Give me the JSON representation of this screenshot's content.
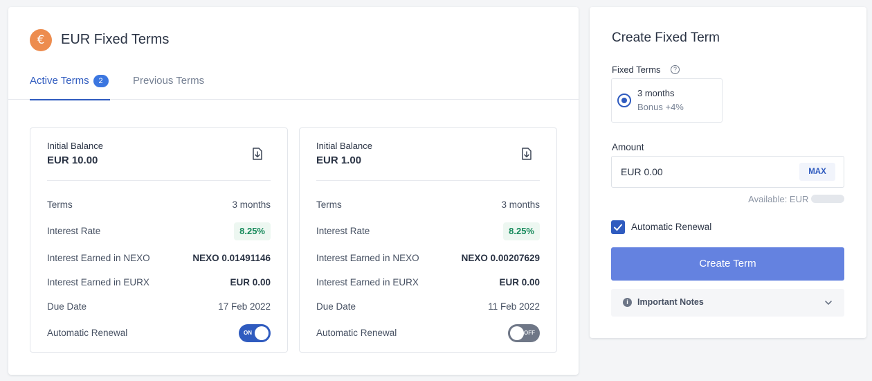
{
  "header": {
    "currency_symbol": "€",
    "title": "EUR Fixed Terms"
  },
  "tabs": {
    "active_label": "Active Terms",
    "active_count": "2",
    "previous_label": "Previous Terms"
  },
  "cards": [
    {
      "initial_balance_label": "Initial Balance",
      "initial_balance": "EUR 10.00",
      "rows": {
        "terms_label": "Terms",
        "terms_value": "3 months",
        "rate_label": "Interest Rate",
        "rate_value": "8.25%",
        "nexo_label": "Interest Earned in NEXO",
        "nexo_value": "NEXO 0.01491146",
        "eurx_label": "Interest Earned in EURX",
        "eurx_value": "EUR 0.00",
        "due_label": "Due Date",
        "due_value": "17 Feb 2022",
        "renew_label": "Automatic Renewal",
        "renew_state": "ON"
      }
    },
    {
      "initial_balance_label": "Initial Balance",
      "initial_balance": "EUR 1.00",
      "rows": {
        "terms_label": "Terms",
        "terms_value": "3 months",
        "rate_label": "Interest Rate",
        "rate_value": "8.25%",
        "nexo_label": "Interest Earned in NEXO",
        "nexo_value": "NEXO 0.00207629",
        "eurx_label": "Interest Earned in EURX",
        "eurx_value": "EUR 0.00",
        "due_label": "Due Date",
        "due_value": "11 Feb 2022",
        "renew_label": "Automatic Renewal",
        "renew_state": "OFF"
      }
    }
  ],
  "create": {
    "title": "Create Fixed Term",
    "fixed_terms_label": "Fixed Terms",
    "option_title": "3 months",
    "option_bonus": "Bonus +4%",
    "amount_label": "Amount",
    "amount_value": "EUR 0.00",
    "max_label": "MAX",
    "available_label": "Available: EUR",
    "renewal_label": "Automatic Renewal",
    "renewal_checked": true,
    "button_label": "Create Term",
    "notes_label": "Important Notes"
  },
  "colors": {
    "accent": "#2f5bbf",
    "button": "#6482e0",
    "euro_badge": "#ed8c4e",
    "rate_green": "#15895a"
  }
}
